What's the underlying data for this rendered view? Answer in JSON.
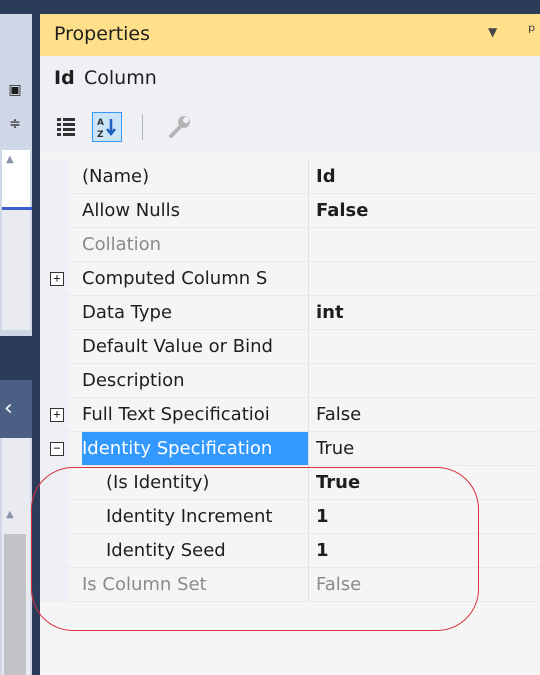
{
  "window": {
    "title": "Properties",
    "object_name": "Id",
    "object_type": "Column"
  },
  "toolbar": {
    "categorized_icon": "categorized-icon",
    "alphabetical_icon": "alphabetical-icon",
    "property_pages_icon": "wrench-icon"
  },
  "properties": [
    {
      "name": "(Name)",
      "value": "Id",
      "value_bold": true,
      "disabled": false
    },
    {
      "name": "Allow Nulls",
      "value": "False",
      "value_bold": true,
      "disabled": false
    },
    {
      "name": "Collation",
      "value": "",
      "value_bold": false,
      "disabled": true
    },
    {
      "name": "Computed Column S",
      "value": "",
      "value_bold": false,
      "disabled": false,
      "expander": "+"
    },
    {
      "name": "Data Type",
      "value": "int",
      "value_bold": true,
      "disabled": false
    },
    {
      "name": "Default Value or Bind",
      "value": "",
      "value_bold": false,
      "disabled": false
    },
    {
      "name": "Description",
      "value": "",
      "value_bold": false,
      "disabled": false
    },
    {
      "name": "Full Text Specificatioi",
      "value": "False",
      "value_bold": false,
      "disabled": false,
      "expander": "+"
    },
    {
      "name": "Identity Specification",
      "value": "True",
      "value_bold": false,
      "disabled": false,
      "expander": "−",
      "selected": true
    },
    {
      "name": "(Is Identity)",
      "value": "True",
      "value_bold": true,
      "disabled": false,
      "child": true
    },
    {
      "name": "Identity Increment",
      "value": "1",
      "value_bold": true,
      "disabled": false,
      "child": true
    },
    {
      "name": "Identity Seed",
      "value": "1",
      "value_bold": true,
      "disabled": false,
      "child": true
    },
    {
      "name": "Is Column Set",
      "value": "False",
      "value_bold": false,
      "disabled": true
    }
  ],
  "colors": {
    "titlebar": "#ffe08a",
    "selection": "#3399ff",
    "annotation": "#d7303d",
    "frame": "#2b3c59"
  }
}
